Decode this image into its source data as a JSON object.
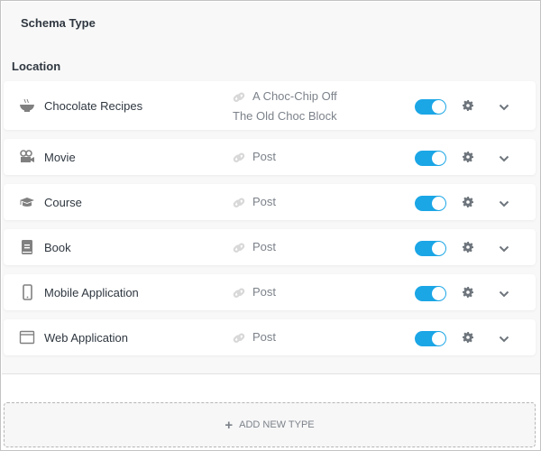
{
  "header": {
    "title": "Schema Type",
    "location_label": "Location"
  },
  "colors": {
    "toggle_on": "#1ba6e6",
    "icon_gray": "#808080"
  },
  "rows": [
    {
      "icon": "bowl-icon",
      "name": "Chocolate Recipes",
      "location_line1": "A Choc-Chip Off",
      "location_line2": "The Old Choc Block",
      "enabled": true
    },
    {
      "icon": "video-camera-icon",
      "name": "Movie",
      "location_line1": "Post",
      "enabled": true
    },
    {
      "icon": "graduation-cap-icon",
      "name": "Course",
      "location_line1": "Post",
      "enabled": true
    },
    {
      "icon": "book-icon",
      "name": "Book",
      "location_line1": "Post",
      "enabled": true
    },
    {
      "icon": "mobile-phone-icon",
      "name": "Mobile Application",
      "location_line1": "Post",
      "enabled": true
    },
    {
      "icon": "browser-window-icon",
      "name": "Web Application",
      "location_line1": "Post",
      "enabled": true
    }
  ],
  "add_button": {
    "icon": "plus-icon",
    "label": "ADD NEW TYPE"
  }
}
